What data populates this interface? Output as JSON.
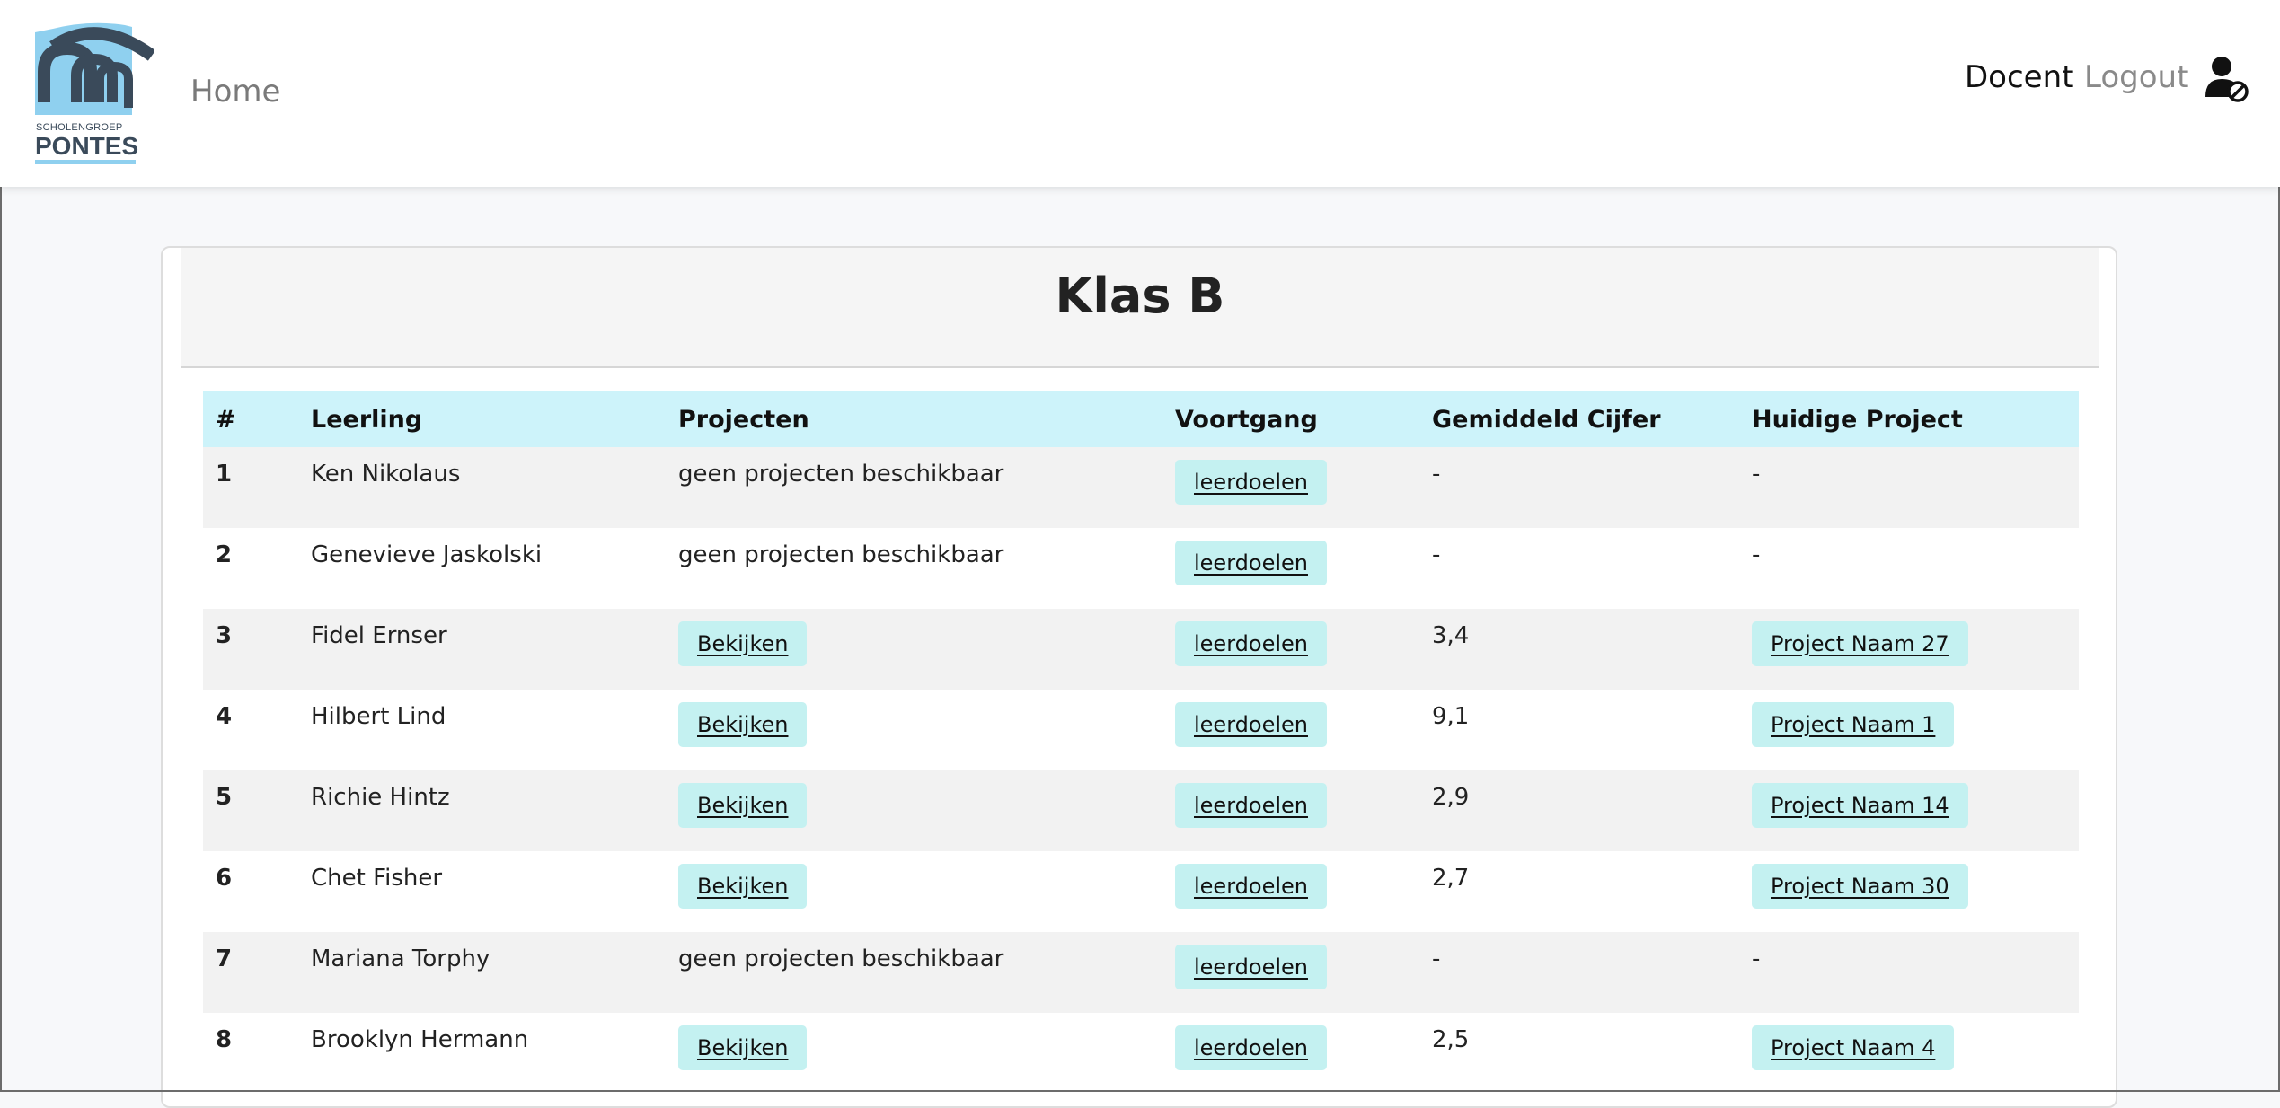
{
  "brand": {
    "logo_small_text": "SCHOLENGROEP",
    "logo_big_text": "PONTES",
    "colors": {
      "logo_blue": "#8fd0ef",
      "logo_dark": "#3a4a5a",
      "header_row": "#cdf3fa",
      "button": "#c4f1f1"
    }
  },
  "nav": {
    "home": "Home",
    "docent": "Docent",
    "logout": "Logout",
    "user_icon": "user-slash-icon"
  },
  "card": {
    "title": "Klas B"
  },
  "table": {
    "headers": [
      "#",
      "Leerling",
      "Projecten",
      "Voortgang",
      "Gemiddeld Cijfer",
      "Huidige Project"
    ],
    "rows": [
      {
        "nr": "1",
        "name": "Ken Nikolaus",
        "projects": "geen projecten beschikbaar",
        "projects_is_button": false,
        "progress": "leerdoelen",
        "grade": "-",
        "current": "-",
        "current_is_button": false
      },
      {
        "nr": "2",
        "name": "Genevieve Jaskolski",
        "projects": "geen projecten beschikbaar",
        "projects_is_button": false,
        "progress": "leerdoelen",
        "grade": "-",
        "current": "-",
        "current_is_button": false
      },
      {
        "nr": "3",
        "name": "Fidel Ernser",
        "projects": "Bekijken",
        "projects_is_button": true,
        "progress": "leerdoelen",
        "grade": "3,4",
        "current": "Project Naam 27",
        "current_is_button": true
      },
      {
        "nr": "4",
        "name": "Hilbert Lind",
        "projects": "Bekijken",
        "projects_is_button": true,
        "progress": "leerdoelen",
        "grade": "9,1",
        "current": "Project Naam 1",
        "current_is_button": true
      },
      {
        "nr": "5",
        "name": "Richie Hintz",
        "projects": "Bekijken",
        "projects_is_button": true,
        "progress": "leerdoelen",
        "grade": "2,9",
        "current": "Project Naam 14",
        "current_is_button": true
      },
      {
        "nr": "6",
        "name": "Chet Fisher",
        "projects": "Bekijken",
        "projects_is_button": true,
        "progress": "leerdoelen",
        "grade": "2,7",
        "current": "Project Naam 30",
        "current_is_button": true
      },
      {
        "nr": "7",
        "name": "Mariana Torphy",
        "projects": "geen projecten beschikbaar",
        "projects_is_button": false,
        "progress": "leerdoelen",
        "grade": "-",
        "current": "-",
        "current_is_button": false
      },
      {
        "nr": "8",
        "name": "Brooklyn Hermann",
        "projects": "Bekijken",
        "projects_is_button": true,
        "progress": "leerdoelen",
        "grade": "2,5",
        "current": "Project Naam 4",
        "current_is_button": true
      }
    ]
  }
}
